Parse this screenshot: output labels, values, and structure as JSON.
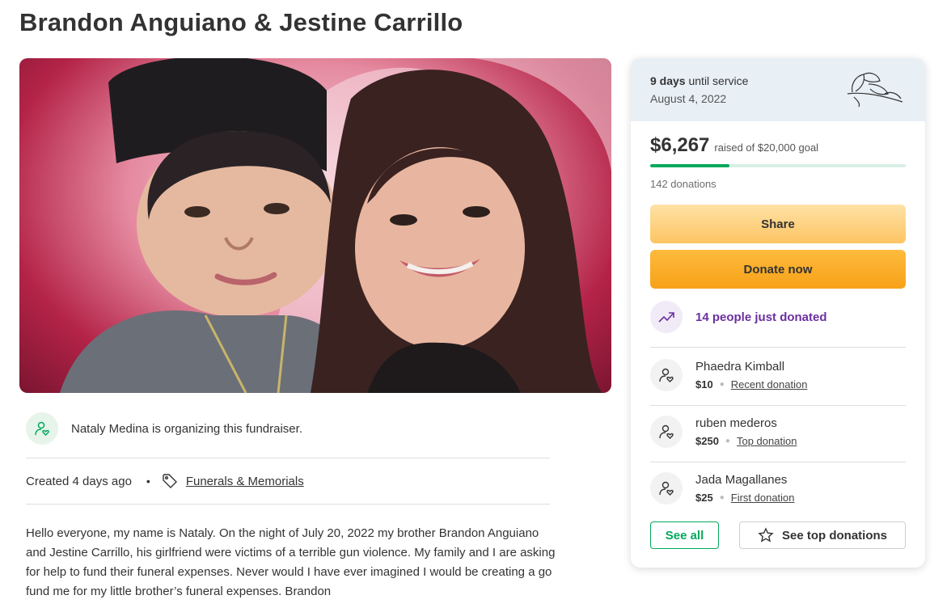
{
  "page": {
    "title": "Brandon Anguiano & Jestine Carrillo"
  },
  "organizer": {
    "text": "Nataly Medina is organizing this fundraiser."
  },
  "meta": {
    "created": "Created 4 days ago",
    "separator": "•",
    "category": "Funerals & Memorials"
  },
  "story": {
    "text": "Hello everyone, my name is Nataly. On the night of July 20, 2022 my brother Brandon Anguiano and Jestine Carrillo, his girlfriend were victims of a terrible gun violence. My family and I are asking for help to fund their funeral expenses. Never would I have ever imagined I would be creating a go fund me for my little brother’s funeral expenses. Brandon"
  },
  "sidebar": {
    "days_count": "9 days",
    "days_suffix": " until service",
    "service_date": "August 4, 2022",
    "raised_amount": "$6,267",
    "goal_text": "raised of $20,000 goal",
    "progress_fraction": 0.31,
    "donations_count": "142 donations",
    "share_label": "Share",
    "donate_label": "Donate now",
    "just_donated": "14 people just donated",
    "donations": [
      {
        "name": "Phaedra Kimball",
        "amount": "$10",
        "type": "Recent donation"
      },
      {
        "name": "ruben mederos",
        "amount": "$250",
        "type": "Top donation"
      },
      {
        "name": "Jada Magallanes",
        "amount": "$25",
        "type": "First donation"
      }
    ],
    "see_all_label": "See all",
    "see_top_label": "See top donations"
  },
  "colors": {
    "accent_green": "#02a95c",
    "donate_orange": "#f7a118",
    "purple": "#6b2fa0"
  },
  "icons": [
    "person-heart-icon",
    "tag-icon",
    "trending-up-icon",
    "star-icon",
    "flower-icon"
  ]
}
